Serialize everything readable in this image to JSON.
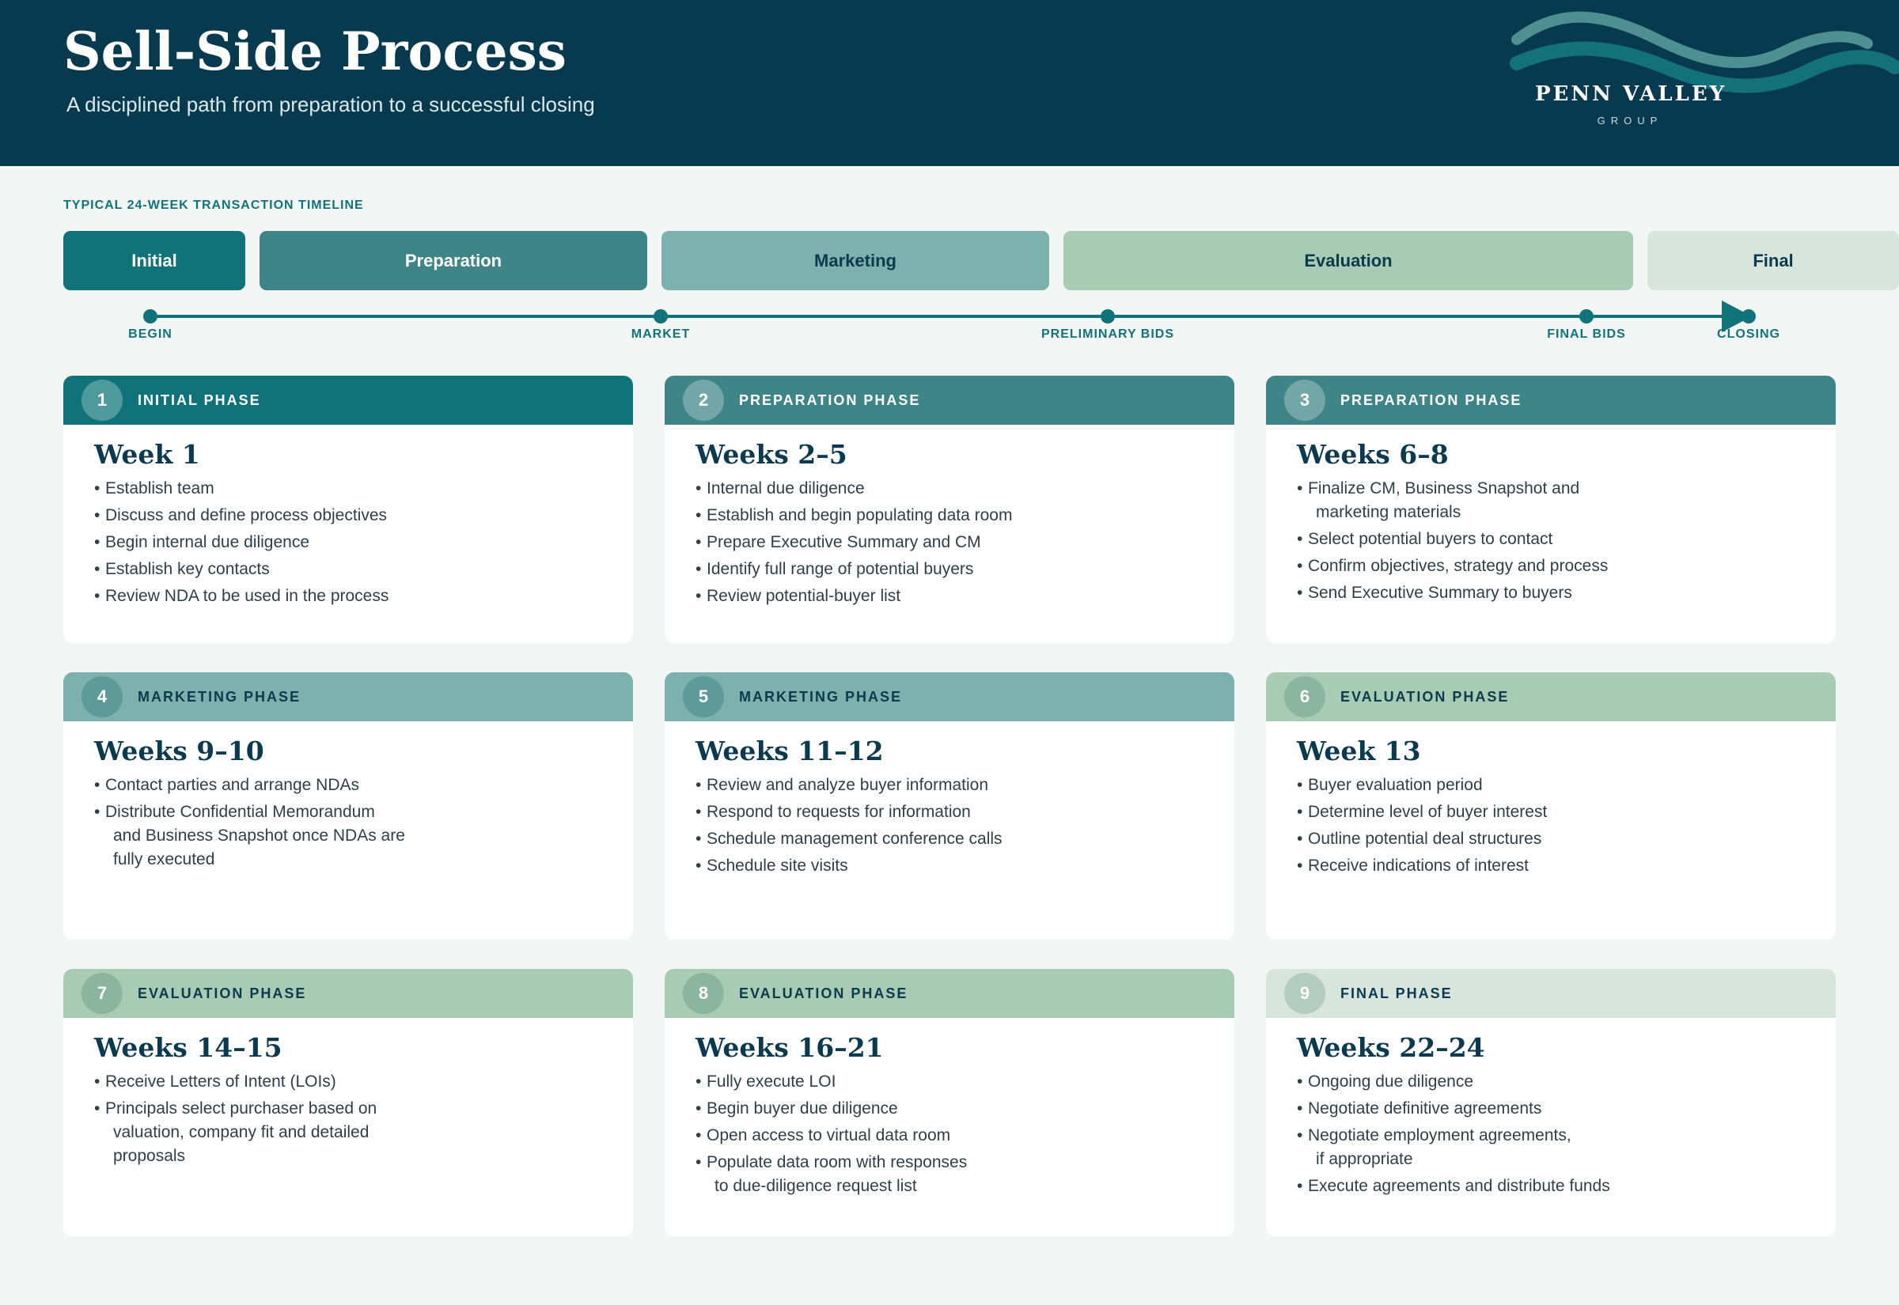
{
  "header": {
    "title": "Sell-Side Process",
    "subtitle": "A disciplined path from preparation to a successful closing",
    "logo_name": "PENN VALLEY",
    "logo_sub": "GROUP"
  },
  "timeline": {
    "label": "TYPICAL 24-WEEK TRANSACTION TIMELINE",
    "phases": [
      "Initial",
      "Preparation",
      "Marketing",
      "Evaluation",
      "Final"
    ],
    "milestones": [
      "BEGIN",
      "MARKET",
      "PRELIMINARY BIDS",
      "FINAL BIDS",
      "CLOSING"
    ]
  },
  "colors": {
    "header_bg": "#083a4f",
    "initial": "#11737a",
    "preparation": "#3f8486",
    "marketing": "#7cb1ad",
    "evaluation": "#a8cbb3",
    "final": "#d7e5dc",
    "accent": "#11737a"
  },
  "cards": [
    {
      "num": "1",
      "phase": "INITIAL PHASE",
      "weeks": "Week 1",
      "bullets": [
        [
          "Establish team"
        ],
        [
          "Discuss and define process objectives"
        ],
        [
          "Begin internal due diligence"
        ],
        [
          "Establish key contacts"
        ],
        [
          "Review NDA to be used in the process"
        ]
      ]
    },
    {
      "num": "2",
      "phase": "PREPARATION PHASE",
      "weeks": "Weeks 2–5",
      "bullets": [
        [
          "Internal due diligence"
        ],
        [
          "Establish and begin populating data room"
        ],
        [
          "Prepare Executive Summary and CM"
        ],
        [
          "Identify full range of potential buyers"
        ],
        [
          "Review potential-buyer list"
        ]
      ]
    },
    {
      "num": "3",
      "phase": "PREPARATION PHASE",
      "weeks": "Weeks 6–8",
      "bullets": [
        [
          "Finalize CM, Business Snapshot and",
          "marketing materials"
        ],
        [
          "Select potential buyers to contact"
        ],
        [
          "Confirm objectives, strategy and process"
        ],
        [
          "Send Executive Summary to buyers"
        ]
      ]
    },
    {
      "num": "4",
      "phase": "MARKETING PHASE",
      "weeks": "Weeks 9–10",
      "bullets": [
        [
          "Contact parties and arrange NDAs"
        ],
        [
          "Distribute Confidential Memorandum",
          "and Business Snapshot once NDAs are",
          "fully executed"
        ]
      ]
    },
    {
      "num": "5",
      "phase": "MARKETING PHASE",
      "weeks": "Weeks 11–12",
      "bullets": [
        [
          "Review and analyze buyer information"
        ],
        [
          "Respond to requests for information"
        ],
        [
          "Schedule management conference calls"
        ],
        [
          "Schedule site visits"
        ]
      ]
    },
    {
      "num": "6",
      "phase": "EVALUATION PHASE",
      "weeks": "Week 13",
      "bullets": [
        [
          "Buyer evaluation period"
        ],
        [
          "Determine level of buyer interest"
        ],
        [
          "Outline potential deal structures"
        ],
        [
          "Receive indications of interest"
        ]
      ]
    },
    {
      "num": "7",
      "phase": "EVALUATION PHASE",
      "weeks": "Weeks 14–15",
      "bullets": [
        [
          "Receive Letters of Intent (LOIs)"
        ],
        [
          "Principals select purchaser based on",
          "valuation, company fit and detailed",
          "proposals"
        ]
      ]
    },
    {
      "num": "8",
      "phase": "EVALUATION PHASE",
      "weeks": "Weeks 16–21",
      "bullets": [
        [
          "Fully execute LOI"
        ],
        [
          "Begin buyer due diligence"
        ],
        [
          "Open access to virtual data room"
        ],
        [
          "Populate data room with responses",
          "to due-diligence request list"
        ]
      ]
    },
    {
      "num": "9",
      "phase": "FINAL PHASE",
      "weeks": "Weeks 22–24",
      "bullets": [
        [
          "Ongoing due diligence"
        ],
        [
          "Negotiate definitive agreements"
        ],
        [
          "Negotiate employment agreements,",
          "if appropriate"
        ],
        [
          "Execute agreements and distribute funds"
        ]
      ]
    }
  ]
}
